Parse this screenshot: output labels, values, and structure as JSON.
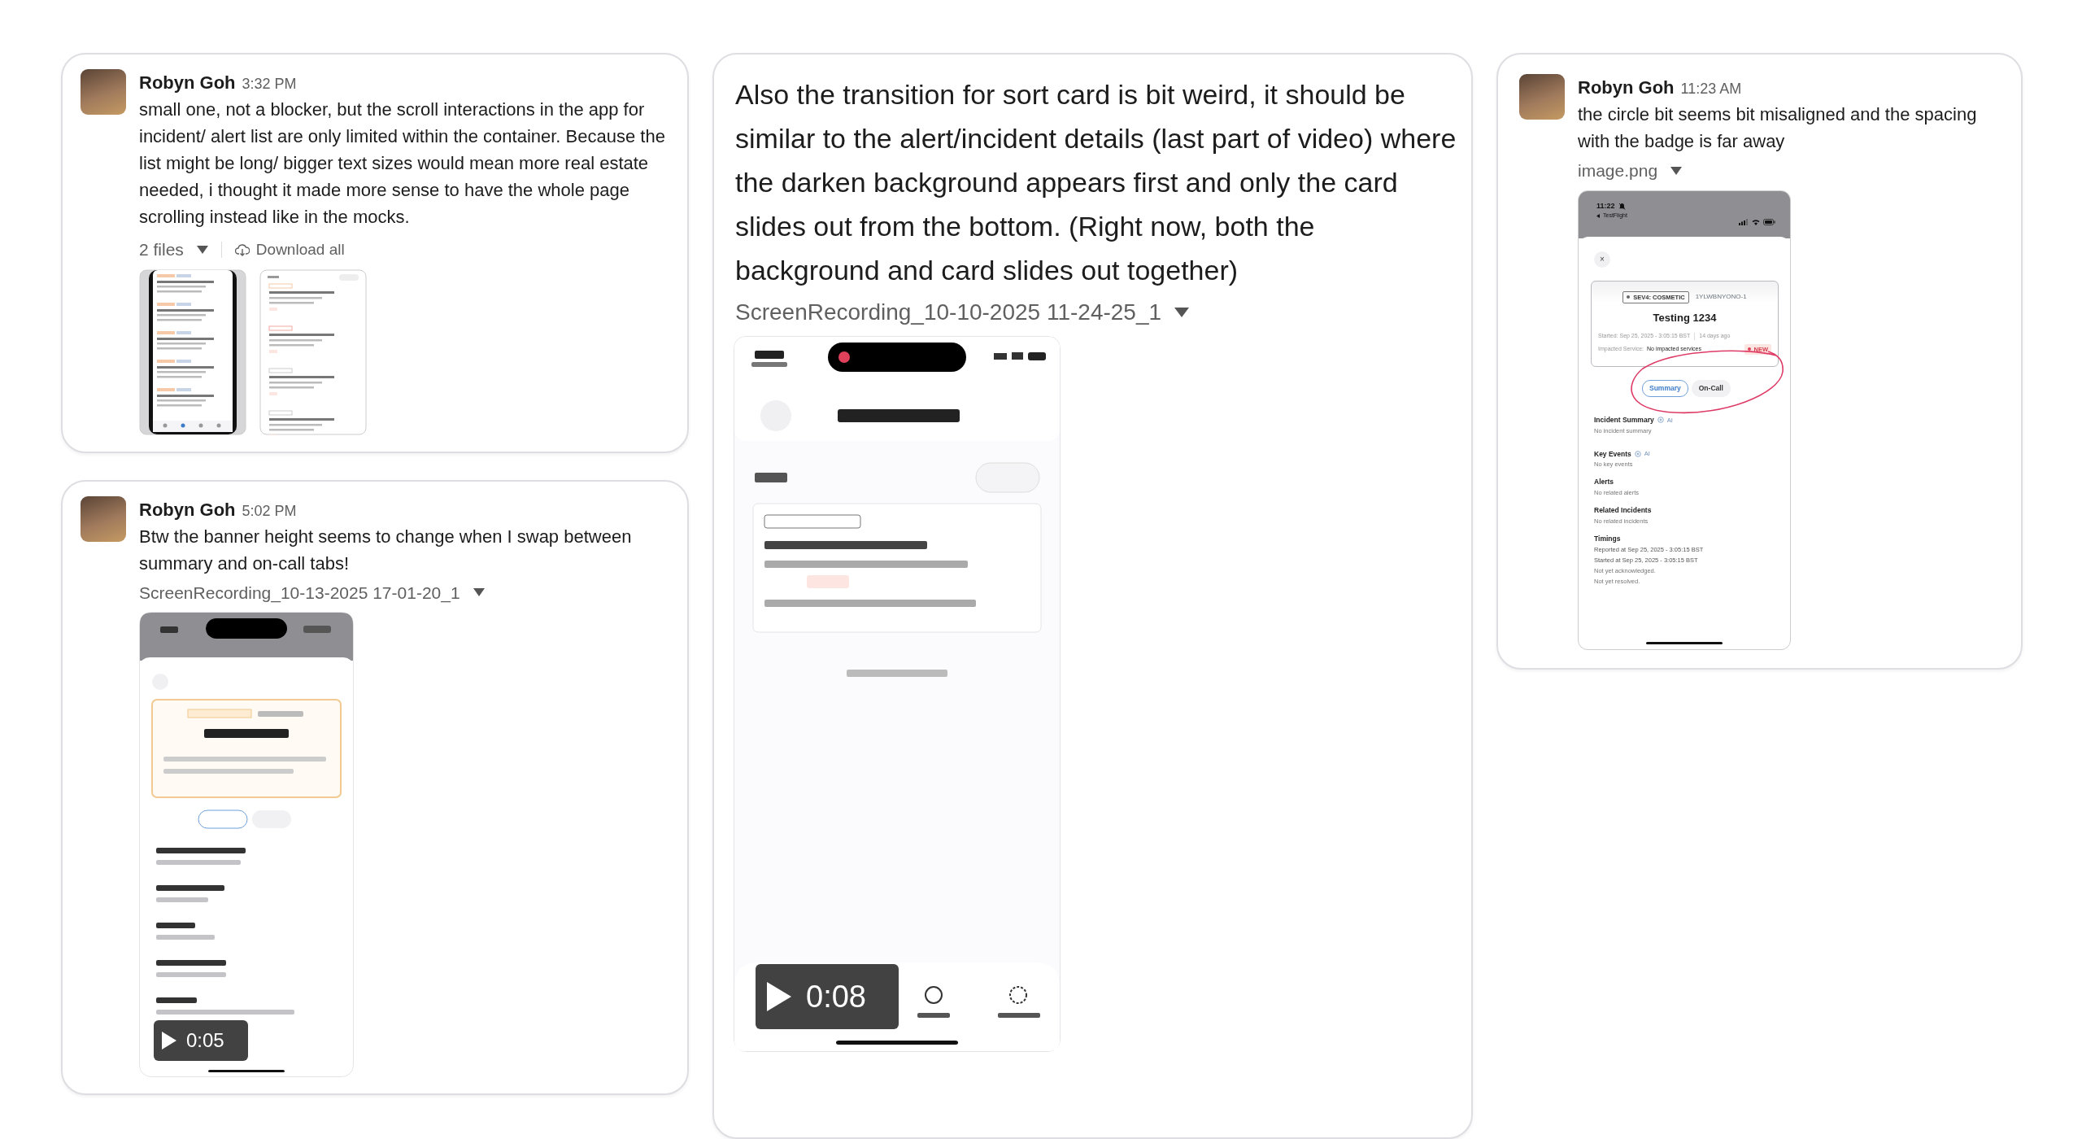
{
  "messages": [
    {
      "author": "Robyn Goh",
      "time": "3:32 PM",
      "text": "small one, not a blocker, but the scroll interactions in the app for incident/ alert list are only limited within the container. Because the list might be long/ bigger text sizes would mean more real estate needed, i thought it made more sense to have the whole page scrolling instead like in the mocks.",
      "attachment": {
        "kind": "files",
        "label": "2 files",
        "download": "Download all",
        "thumbnails": [
          {
            "kind": "phone"
          },
          {
            "kind": "list"
          }
        ]
      }
    },
    {
      "author": "Robyn Goh",
      "time": "5:02 PM",
      "text": "Btw the banner height seems to change when I swap between summary and on-call tabs!",
      "attachment": {
        "kind": "video",
        "filename": "ScreenRecording_10-13-2025 17-01-20_1",
        "duration": "0:05"
      }
    },
    {
      "text": "Also the transition for sort card is bit weird, it should be similar to the alert/incident details (last part of video) where the darken background appears first and only the card slides out from the bottom. (Right now, both the background and card slides out together)",
      "attachment": {
        "kind": "video",
        "filename": "ScreenRecording_10-10-2025 11-24-25_1",
        "duration": "0:08"
      }
    },
    {
      "author": "Robyn Goh",
      "time": "11:23 AM",
      "text": "the circle bit seems bit misaligned and the spacing with the badge is far away",
      "attachment": {
        "kind": "image",
        "filename": "image.png",
        "screen": {
          "status": {
            "time": "11:22",
            "app": "TestFlight"
          },
          "close": "×",
          "incident": {
            "severity": "SEV4: COSMETIC",
            "id": "1YLWBNYONO-1",
            "title": "Testing 1234",
            "started": "Started: Sep 25, 2025 - 3:05:15 BST",
            "age": "14 days ago",
            "impacted_label": "Impacted Service:",
            "impacted_value": "No impacted services",
            "status": "NEW"
          },
          "tabs": [
            {
              "label": "Summary",
              "selected": true
            },
            {
              "label": "On-Call",
              "selected": false
            }
          ],
          "sections": [
            {
              "title": "Incident Summary",
              "ai": "AI",
              "lines": [
                "No incident summary"
              ]
            },
            {
              "title": "Key Events",
              "ai": "AI",
              "lines": [
                "No key events"
              ]
            },
            {
              "title": "Alerts",
              "lines": [
                "No related alerts"
              ]
            },
            {
              "title": "Related Incidents",
              "lines": [
                "No related incidents"
              ]
            },
            {
              "title": "Timings",
              "lines": [
                "Reported at Sep 25, 2025 - 3:05:15 BST",
                "Started at Sep 25, 2025 - 3:05:15 BST",
                "Not yet acknowledged.",
                "Not yet resolved."
              ]
            }
          ],
          "annotation": true
        }
      }
    }
  ]
}
